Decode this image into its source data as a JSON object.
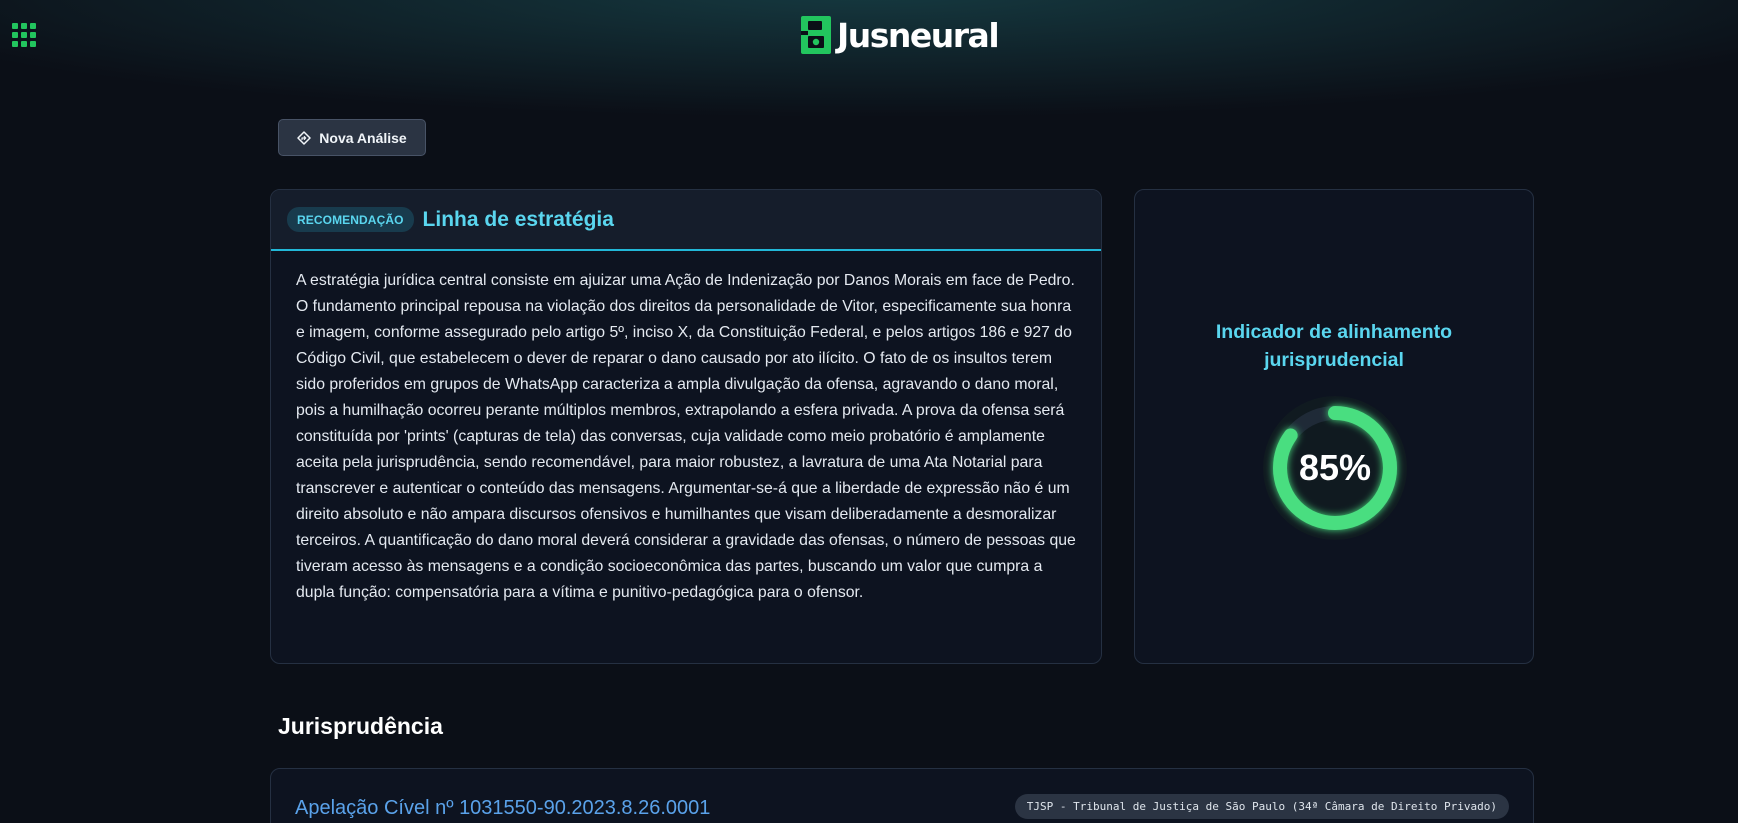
{
  "header": {
    "brand_name": "Jusneural",
    "apps_icon": "grid-icon",
    "logo_icon": "jusneural-logo-icon"
  },
  "toolbar": {
    "new_analysis_label": "Nova Análise",
    "new_analysis_icon": "diamond-arrow-icon"
  },
  "strategy": {
    "badge": "RECOMENDAÇÃO",
    "title": "Linha de estratégia",
    "text": "A estratégia jurídica central consiste em ajuizar uma Ação de Indenização por Danos Morais em face de Pedro. O fundamento principal repousa na violação dos direitos da personalidade de Vitor, especificamente sua honra e imagem, conforme assegurado pelo artigo 5º, inciso X, da Constituição Federal, e pelos artigos 186 e 927 do Código Civil, que estabelecem o dever de reparar o dano causado por ato ilícito. O fato de os insultos terem sido proferidos em grupos de WhatsApp caracteriza a ampla divulgação da ofensa, agravando o dano moral, pois a humilhação ocorreu perante múltiplos membros, extrapolando a esfera privada. A prova da ofensa será constituída por 'prints' (capturas de tela) das conversas, cuja validade como meio probatório é amplamente aceita pela jurisprudência, sendo recomendável, para maior robustez, a lavratura de uma Ata Notarial para transcrever e autenticar o conteúdo das mensagens. Argumentar-se-á que a liberdade de expressão não é um direito absoluto e não ampara discursos ofensivos e humilhantes que visam deliberadamente a desmoralizar terceiros. A quantificação do dano moral deverá considerar a gravidade das ofensas, o número de pessoas que tiveram acesso às mensagens e a condição socioeconômica das partes, buscando um valor que cumpra a dupla função: compensatória para a vítima e punitivo-pedagógica para o ofensor."
  },
  "indicator": {
    "title": "Indicador de alinhamento jurisprudencial",
    "value_label": "85%",
    "value": 0.85,
    "color": "#4ade80"
  },
  "jurisprudence": {
    "heading": "Jurisprudência",
    "items": [
      {
        "title": "Apelação Cível nº 1031550-90.2023.8.26.0001",
        "court": "TJSP - Tribunal de Justiça de São Paulo (34ª Câmara de Direito Privado)"
      }
    ]
  },
  "colors": {
    "accent": "#5ad6ef",
    "brand": "#22c55e",
    "link": "#5aa2ea",
    "background": "#0b0f17"
  }
}
